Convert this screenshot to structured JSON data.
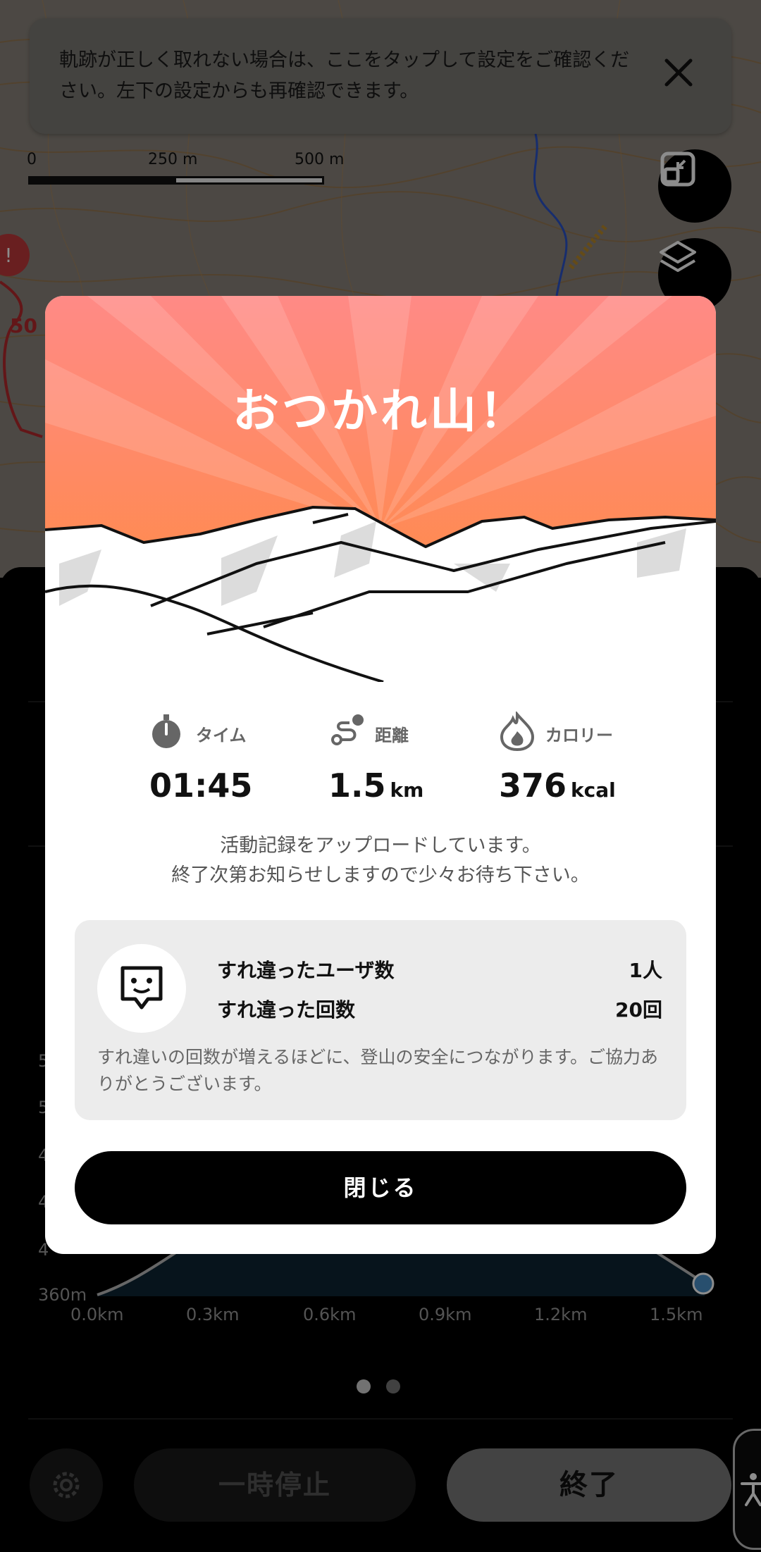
{
  "banner": {
    "text": "軌跡が正しく取れない場合は、ここをタップして設定をご確認ください。左下の設定からも再確認できます。"
  },
  "map": {
    "scale_labels": [
      "0",
      "250 m",
      "500 m"
    ],
    "route_marker_text": "50"
  },
  "elevation_chart": {
    "y_labels": [
      "5",
      "5",
      "4",
      "4",
      "4",
      "360m"
    ],
    "x_labels": [
      "0.0km",
      "0.3km",
      "0.6km",
      "0.9km",
      "1.2km",
      "1.5km"
    ]
  },
  "modal": {
    "title": "おつかれ山！",
    "stats": [
      {
        "label": "タイム",
        "value": "01:45",
        "unit": "",
        "icon": "stopwatch-icon"
      },
      {
        "label": "距離",
        "value": "1.5",
        "unit": "km",
        "icon": "route-icon"
      },
      {
        "label": "カロリー",
        "value": "376",
        "unit": "kcal",
        "icon": "flame-icon"
      }
    ],
    "upload_message_line1": "活動記録をアップロードしています。",
    "upload_message_line2": "終了次第お知らせしますので少々お待ち下さい。",
    "encounter": {
      "users_label": "すれ違ったユーザ数",
      "users_value": "1人",
      "count_label": "すれ違った回数",
      "count_value": "20回",
      "note": "すれ違いの回数が増えるほどに、登山の安全につながります。ご協力ありがとうございます。"
    },
    "close_label": "閉じる"
  },
  "bottom_bar": {
    "pause_label": "一時停止",
    "end_label": "終了"
  },
  "colors": {
    "hero_top": "#ff8a86",
    "hero_bottom": "#ff8b3a",
    "accent_blue": "#4a90c8"
  }
}
